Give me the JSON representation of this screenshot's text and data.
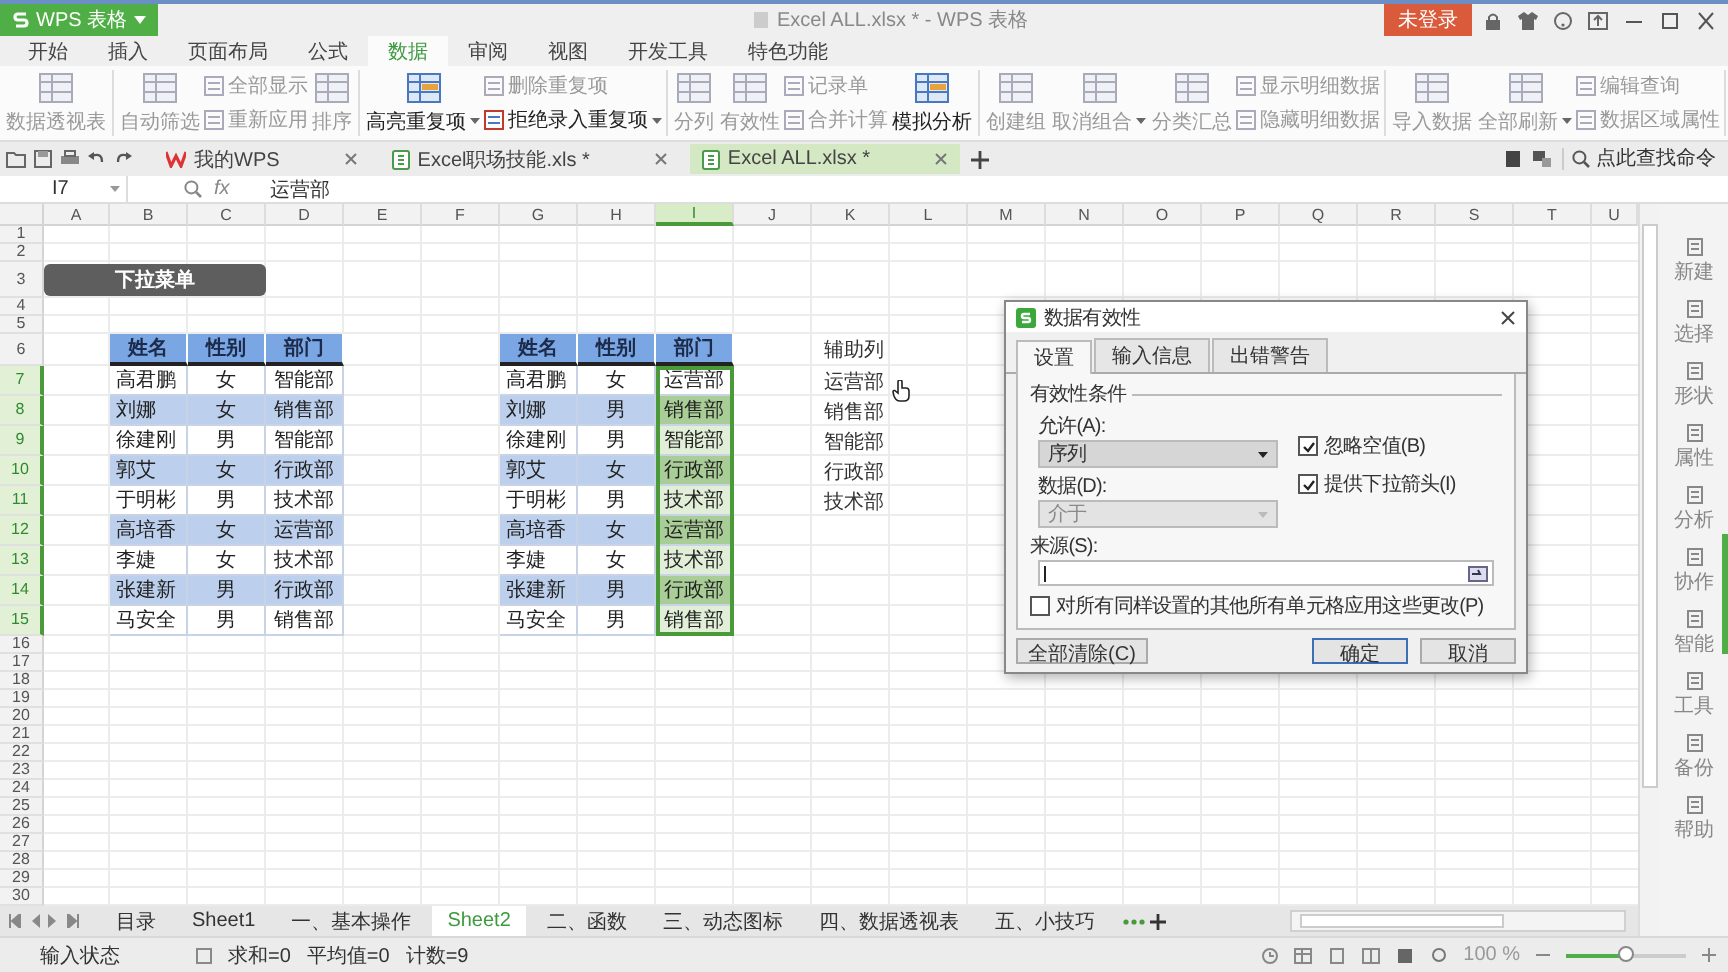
{
  "title_bar": {
    "app_button": "WPS 表格",
    "title": "Excel ALL.xlsx * - WPS 表格",
    "login_button": "未登录"
  },
  "menu_tabs": [
    {
      "label": "开始",
      "selected": false
    },
    {
      "label": "插入",
      "selected": false
    },
    {
      "label": "页面布局",
      "selected": false
    },
    {
      "label": "公式",
      "selected": false
    },
    {
      "label": "数据",
      "selected": true
    },
    {
      "label": "审阅",
      "selected": false
    },
    {
      "label": "视图",
      "selected": false
    },
    {
      "label": "开发工具",
      "selected": false
    },
    {
      "label": "特色功能",
      "selected": false
    }
  ],
  "ribbon": {
    "groups": [
      {
        "columns": [
          [
            {
              "label": "数据透视表",
              "disabled": true
            }
          ]
        ]
      },
      {
        "columns": [
          [
            {
              "label": "自动筛选",
              "disabled": true
            }
          ],
          [
            {
              "label": "全部显示",
              "disabled": true
            },
            {
              "label": "重新应用",
              "disabled": true
            }
          ],
          [
            {
              "label": "排序",
              "disabled": true
            }
          ]
        ]
      },
      {
        "columns": [
          [
            {
              "label": "高亮重复项",
              "disabled": false,
              "menu": true
            }
          ],
          [
            {
              "label": "删除重复项",
              "disabled": true
            },
            {
              "label": "拒绝录入重复项",
              "disabled": false,
              "menu": true
            }
          ]
        ]
      },
      {
        "columns": [
          [
            {
              "label": "分列",
              "disabled": true
            }
          ],
          [
            {
              "label": "有效性",
              "disabled": true
            }
          ],
          [
            {
              "label": "记录单",
              "disabled": true
            },
            {
              "label": "合并计算",
              "disabled": true
            }
          ],
          [
            {
              "label": "模拟分析",
              "disabled": false
            }
          ]
        ]
      },
      {
        "columns": [
          [
            {
              "label": "创建组",
              "disabled": true
            }
          ],
          [
            {
              "label": "取消组合",
              "disabled": true,
              "menu": true
            }
          ],
          [
            {
              "label": "分类汇总",
              "disabled": true
            }
          ],
          [
            {
              "label": "显示明细数据",
              "disabled": true
            },
            {
              "label": "隐藏明细数据",
              "disabled": true
            }
          ]
        ]
      },
      {
        "columns": [
          [
            {
              "label": "导入数据",
              "disabled": true
            }
          ],
          [
            {
              "label": "全部刷新",
              "disabled": true,
              "menu": true
            }
          ],
          [
            {
              "label": "编辑查询",
              "disabled": true
            },
            {
              "label": "数据区域属性",
              "disabled": true
            }
          ]
        ]
      }
    ]
  },
  "doc_tabs": [
    {
      "label": "我的WPS",
      "selected": false
    },
    {
      "label": "Excel职场技能.xls *",
      "selected": false
    },
    {
      "label": "Excel ALL.xlsx *",
      "selected": true
    }
  ],
  "command_search": {
    "placeholder": "点此查找命令"
  },
  "formula_bar": {
    "cell": "I7",
    "function_label": "fx",
    "value": "运营部"
  },
  "columns": [
    {
      "label": "A",
      "selected": false
    },
    {
      "label": "B",
      "selected": false
    },
    {
      "label": "C",
      "selected": false
    },
    {
      "label": "D",
      "selected": false
    },
    {
      "label": "E",
      "selected": false
    },
    {
      "label": "F",
      "selected": false
    },
    {
      "label": "G",
      "selected": false
    },
    {
      "label": "H",
      "selected": false
    },
    {
      "label": "I",
      "selected": true
    },
    {
      "label": "J",
      "selected": false
    },
    {
      "label": "K",
      "selected": false
    },
    {
      "label": "L",
      "selected": false
    },
    {
      "label": "M",
      "selected": false
    },
    {
      "label": "N",
      "selected": false
    },
    {
      "label": "O",
      "selected": false
    },
    {
      "label": "P",
      "selected": false
    },
    {
      "label": "Q",
      "selected": false
    },
    {
      "label": "R",
      "selected": false
    },
    {
      "label": "S",
      "selected": false
    },
    {
      "label": "T",
      "selected": false
    },
    {
      "label": "U",
      "selected": false
    }
  ],
  "rows": [
    {
      "label": "1",
      "selected": false
    },
    {
      "label": "2",
      "selected": false
    },
    {
      "label": "3",
      "selected": false
    },
    {
      "label": "4",
      "selected": false
    },
    {
      "label": "5",
      "selected": false
    },
    {
      "label": "6",
      "selected": false
    },
    {
      "label": "7",
      "selected": true
    },
    {
      "label": "8",
      "selected": true
    },
    {
      "label": "9",
      "selected": true
    },
    {
      "label": "10",
      "selected": true
    },
    {
      "label": "11",
      "selected": true
    },
    {
      "label": "12",
      "selected": true
    },
    {
      "label": "13",
      "selected": true
    },
    {
      "label": "14",
      "selected": true
    },
    {
      "label": "15",
      "selected": true
    },
    {
      "label": "16",
      "selected": false
    },
    {
      "label": "17",
      "selected": false
    },
    {
      "label": "18",
      "selected": false
    },
    {
      "label": "19",
      "selected": false
    },
    {
      "label": "20",
      "selected": false
    },
    {
      "label": "21",
      "selected": false
    },
    {
      "label": "22",
      "selected": false
    },
    {
      "label": "23",
      "selected": false
    },
    {
      "label": "24",
      "selected": false
    },
    {
      "label": "25",
      "selected": false
    },
    {
      "label": "26",
      "selected": false
    },
    {
      "label": "27",
      "selected": false
    },
    {
      "label": "28",
      "selected": false
    },
    {
      "label": "29",
      "selected": false
    },
    {
      "label": "30",
      "selected": false
    }
  ],
  "banner": "下拉菜单",
  "tables": [
    {
      "headers": [
        "姓名",
        "性别",
        "部门"
      ],
      "rows": [
        {
          "name": "高君鹏",
          "gender": "女",
          "dept": "智能部"
        },
        {
          "name": "刘娜",
          "gender": "女",
          "dept": "销售部"
        },
        {
          "name": "徐建刚",
          "gender": "男",
          "dept": "智能部"
        },
        {
          "name": "郭艾",
          "gender": "女",
          "dept": "行政部"
        },
        {
          "name": "于明彬",
          "gender": "男",
          "dept": "技术部"
        },
        {
          "name": "高培香",
          "gender": "女",
          "dept": "运营部"
        },
        {
          "name": "李婕",
          "gender": "女",
          "dept": "技术部"
        },
        {
          "name": "张建新",
          "gender": "男",
          "dept": "行政部"
        },
        {
          "name": "马安全",
          "gender": "男",
          "dept": "销售部"
        }
      ]
    },
    {
      "headers": [
        "姓名",
        "性别",
        "部门"
      ],
      "rows": [
        {
          "name": "高君鹏",
          "gender": "女",
          "dept": "运营部",
          "selected": true
        },
        {
          "name": "刘娜",
          "gender": "男",
          "dept": "销售部",
          "selected": true
        },
        {
          "name": "徐建刚",
          "gender": "男",
          "dept": "智能部",
          "selected": true
        },
        {
          "name": "郭艾",
          "gender": "女",
          "dept": "行政部",
          "selected": true
        },
        {
          "name": "于明彬",
          "gender": "男",
          "dept": "技术部",
          "selected": true
        },
        {
          "name": "高培香",
          "gender": "女",
          "dept": "运营部",
          "selected": true
        },
        {
          "name": "李婕",
          "gender": "女",
          "dept": "技术部",
          "selected": true
        },
        {
          "name": "张建新",
          "gender": "男",
          "dept": "行政部",
          "selected": true
        },
        {
          "name": "马安全",
          "gender": "男",
          "dept": "销售部",
          "selected": true
        }
      ]
    }
  ],
  "helper_list": [
    "辅助列",
    "运营部",
    "销售部",
    "智能部",
    "行政部",
    "技术部"
  ],
  "dialog": {
    "title": "数据有效性",
    "tabs": [
      {
        "label": "设置",
        "selected": true
      },
      {
        "label": "输入信息",
        "selected": false
      },
      {
        "label": "出错警告",
        "selected": false
      }
    ],
    "group_label": "有效性条件",
    "allow_label": "允许(A):",
    "allow_value": "序列",
    "data_label": "数据(D):",
    "data_value": "介于",
    "data_disabled": true,
    "checks": [
      {
        "label": "忽略空值(B)",
        "checked": true
      },
      {
        "label": "提供下拉箭头(I)",
        "checked": true
      }
    ],
    "source_label": "来源(S):",
    "apply_all": {
      "label": "对所有同样设置的其他所有单元格应用这些更改(P)",
      "checked": false
    },
    "buttons": [
      {
        "label": "全部清除(C)",
        "focused": false
      },
      {
        "label": "确定",
        "focused": true
      },
      {
        "label": "取消",
        "focused": false
      }
    ]
  },
  "sheet_tabs": [
    {
      "label": "目录",
      "selected": false
    },
    {
      "label": "Sheet1",
      "selected": false
    },
    {
      "label": "一、基本操作",
      "selected": false
    },
    {
      "label": "Sheet2",
      "selected": true
    },
    {
      "label": "二、函数",
      "selected": false
    },
    {
      "label": "三、动态图标",
      "selected": false
    },
    {
      "label": "四、数据透视表",
      "selected": false
    },
    {
      "label": "五、小技巧",
      "selected": false
    }
  ],
  "status_bar": {
    "mode": "输入状态",
    "stats": [
      "求和=0",
      "平均值=0",
      "计数=9"
    ],
    "zoom": "100 %",
    "level": 0.5
  },
  "side_panel": [
    "新建",
    "选择",
    "形状",
    "属性",
    "分析",
    "协作",
    "智能",
    "工具",
    "备份",
    "帮助"
  ]
}
